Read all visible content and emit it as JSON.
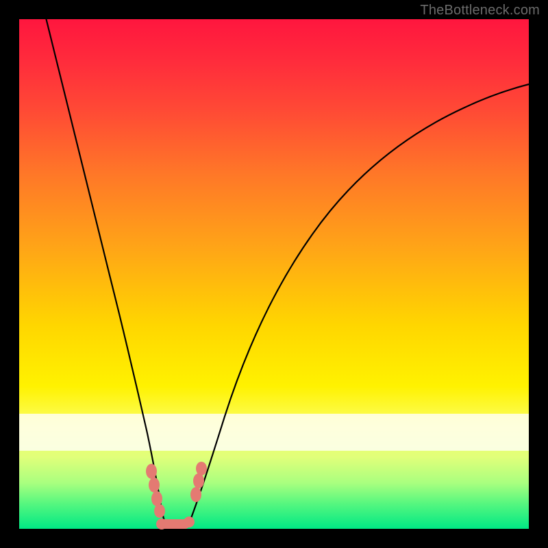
{
  "watermark": "TheBottleneck.com",
  "colors": {
    "gradient_top": "#ff163e",
    "gradient_mid": "#ffd600",
    "gradient_bottom": "#00e884",
    "curve_stroke": "#000000",
    "marker_fill": "#e47a72",
    "frame_bg": "#000000"
  },
  "chart_data": {
    "type": "line",
    "title": "",
    "xlabel": "",
    "ylabel": "",
    "xlim": [
      0,
      100
    ],
    "ylim": [
      0,
      100
    ],
    "grid": false,
    "legend": false,
    "series": [
      {
        "name": "curve",
        "x": [
          0,
          3,
          6,
          9,
          12,
          15,
          18,
          20,
          22,
          24,
          25,
          26,
          27,
          28,
          29,
          30,
          32,
          35,
          40,
          46,
          54,
          62,
          72,
          84,
          100
        ],
        "y": [
          100,
          87,
          75,
          63,
          51,
          40,
          29,
          22,
          15,
          8,
          5,
          2,
          1,
          0.5,
          1,
          2,
          6,
          15,
          30,
          45,
          58,
          67,
          75,
          81,
          86
        ]
      }
    ],
    "annotations": [
      {
        "kind": "marker",
        "x": 24.0,
        "y": 8.0
      },
      {
        "kind": "marker",
        "x": 24.8,
        "y": 5.5
      },
      {
        "kind": "marker",
        "x": 25.6,
        "y": 3.0
      },
      {
        "kind": "marker",
        "x": 32.0,
        "y": 6.0
      },
      {
        "kind": "marker",
        "x": 32.8,
        "y": 8.5
      },
      {
        "kind": "flat",
        "x": 26.5,
        "y": 0.5,
        "w": 4.5
      }
    ],
    "guide_band": {
      "y_center": 21,
      "height": 7
    }
  }
}
